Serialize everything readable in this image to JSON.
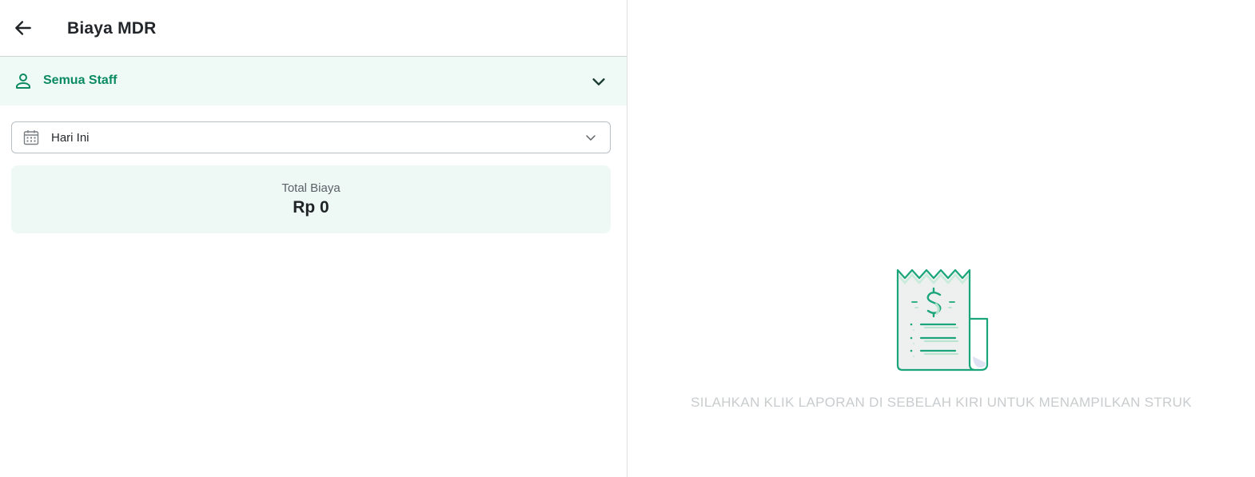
{
  "header": {
    "title": "Biaya MDR",
    "back_icon": "arrow-left-icon"
  },
  "staff_filter": {
    "label": "Semua Staff",
    "icon": "person-icon",
    "expand_icon": "chevron-down-icon"
  },
  "date_filter": {
    "label": "Hari Ini",
    "icon": "calendar-icon",
    "expand_icon": "chevron-down-icon"
  },
  "summary": {
    "label": "Total Biaya",
    "value": "Rp 0"
  },
  "receipt_panel": {
    "illustration": "receipt-dollar-icon",
    "message": "SILAHKAN KLIK LAPORAN DI SEBELAH KIRI UNTUK MENAMPILKAN STRUK"
  },
  "colors": {
    "accent": "#0b8a62",
    "illustration_green": "#1aa67a",
    "staff_bar_bg": "#effaf6",
    "card_bg": "#eef8f5",
    "muted_text": "#c9ccce"
  }
}
